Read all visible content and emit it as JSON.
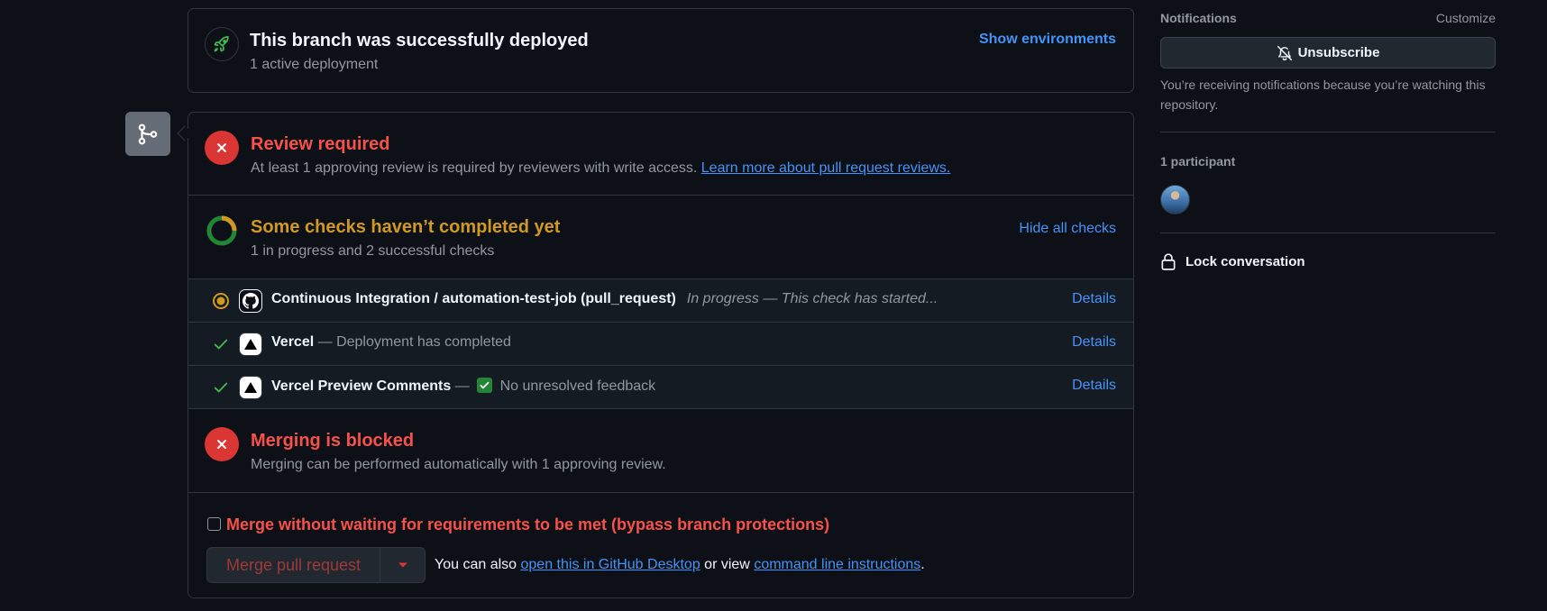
{
  "deployment": {
    "title": "This branch was successfully deployed",
    "subtitle": "1 active deployment",
    "show_environments": "Show environments"
  },
  "review": {
    "title": "Review required",
    "description": "At least 1 approving review is required by reviewers with write access.",
    "learn_more": "Learn more about pull request reviews."
  },
  "checks": {
    "title": "Some checks haven’t completed yet",
    "subtitle": "1 in progress and 2 successful checks",
    "hide_all": "Hide all checks",
    "items": [
      {
        "name": "Continuous Integration / automation-test-job (pull_request)",
        "status_text": "In progress — This check has started...",
        "details": "Details",
        "state": "in-progress",
        "logo": "github-icon"
      },
      {
        "name": "Vercel",
        "separator": "—",
        "status_text": "Deployment has completed",
        "details": "Details",
        "state": "success",
        "logo": "vercel-icon"
      },
      {
        "name": "Vercel Preview Comments",
        "separator": "—",
        "status_text": "No unresolved feedback",
        "details": "Details",
        "state": "success",
        "logo": "vercel-icon"
      }
    ]
  },
  "blocked": {
    "title": "Merging is blocked",
    "subtitle": "Merging can be performed automatically with 1 approving review."
  },
  "merge": {
    "bypass_label": "Merge without waiting for requirements to be met (bypass branch protections)",
    "bypass_checked": false,
    "merge_button": "Merge pull request",
    "also_prefix": "You can also",
    "desktop_link": "open this in GitHub Desktop",
    "or_view": "or view",
    "cli_link": "command line instructions",
    "suffix": "."
  },
  "sidebar": {
    "notifications_label": "Notifications",
    "customize": "Customize",
    "unsubscribe": "Unsubscribe",
    "notif_description": "You’re receiving notifications because you’re watching this repository.",
    "participants_label": "1 participant",
    "lock_label": "Lock conversation"
  },
  "colors": {
    "background": "#0d1117",
    "border": "#30363d",
    "link": "#4493f8",
    "danger": "#f85149",
    "danger_fill": "#da3633",
    "attention": "#d29922",
    "success": "#3fb950",
    "muted": "#9198a1"
  }
}
